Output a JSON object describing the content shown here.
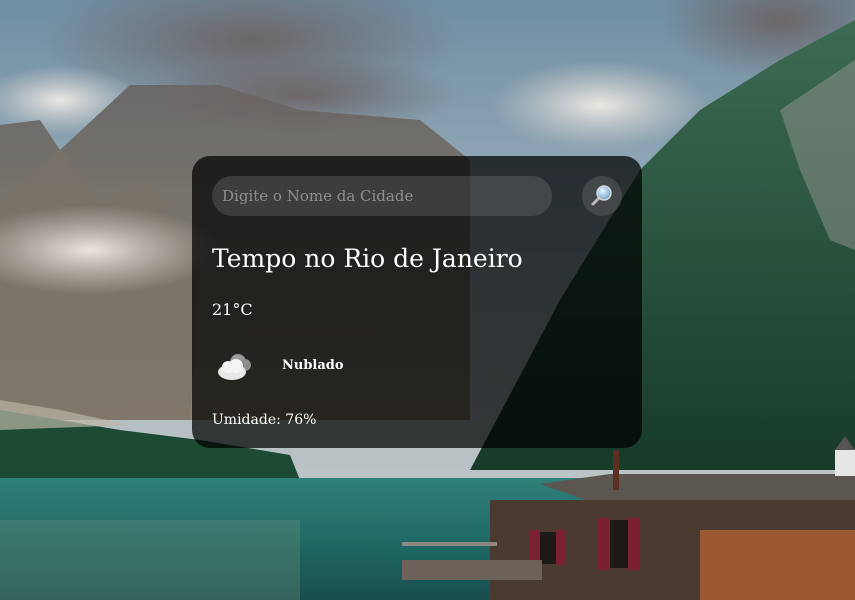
{
  "search": {
    "placeholder": "Digite o Nome da Cidade",
    "value": "",
    "button_icon": "magnifying-glass-icon"
  },
  "weather": {
    "title": "Tempo no Rio de Janeiro",
    "temperature": "21°C",
    "condition_icon": "cloudy-icon",
    "description": "Nublado",
    "humidity_label": "Umidade:",
    "humidity_value": "76%"
  },
  "colors": {
    "card_background": "rgba(0,0,0,0.72)",
    "text": "#ffffff",
    "input_background": "rgba(110,110,110,0.38)",
    "placeholder": "#8e8e8e"
  }
}
